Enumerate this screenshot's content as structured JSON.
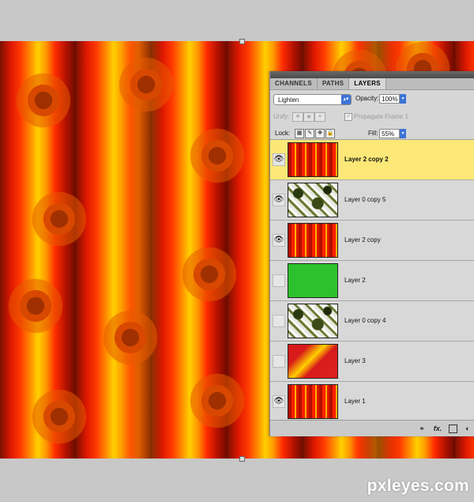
{
  "panel": {
    "tabs": [
      {
        "label": "CHANNELS",
        "active": false
      },
      {
        "label": "PATHS",
        "active": false
      },
      {
        "label": "LAYERS",
        "active": true
      }
    ],
    "blend_mode": "Lighten",
    "opacity_label": "Opacity:",
    "opacity_value": "100%",
    "unify_label": "Unify:",
    "propagate_label": "Propagate Frame 1",
    "lock_label": "Lock:",
    "fill_label": "Fill:",
    "fill_value": "55%",
    "layers": [
      {
        "name": "Layer 2 copy 2",
        "visible": true,
        "selected": true,
        "thumb": "red-stripes"
      },
      {
        "name": "Layer 0 copy 5",
        "visible": true,
        "selected": false,
        "thumb": "camouflage"
      },
      {
        "name": "Layer 2 copy",
        "visible": true,
        "selected": false,
        "thumb": "red-stripes"
      },
      {
        "name": "Layer 2",
        "visible": false,
        "selected": false,
        "thumb": "solid-green"
      },
      {
        "name": "Layer 0 copy 4",
        "visible": false,
        "selected": false,
        "thumb": "camouflage"
      },
      {
        "name": "Layer 3",
        "visible": false,
        "selected": false,
        "thumb": "red-yellow-gradient"
      },
      {
        "name": "Layer 1",
        "visible": true,
        "selected": false,
        "thumb": "red-stripes"
      }
    ],
    "footer_icons": [
      "link-icon",
      "fx-icon",
      "mask-icon",
      "adjustment-icon"
    ],
    "fx_label": "fx."
  },
  "watermark": "pxleyes.com",
  "colors": {
    "selected_layer": "#fce877",
    "panel_bg": "#d6d6d6",
    "accent_blue": "#3d73d6"
  }
}
